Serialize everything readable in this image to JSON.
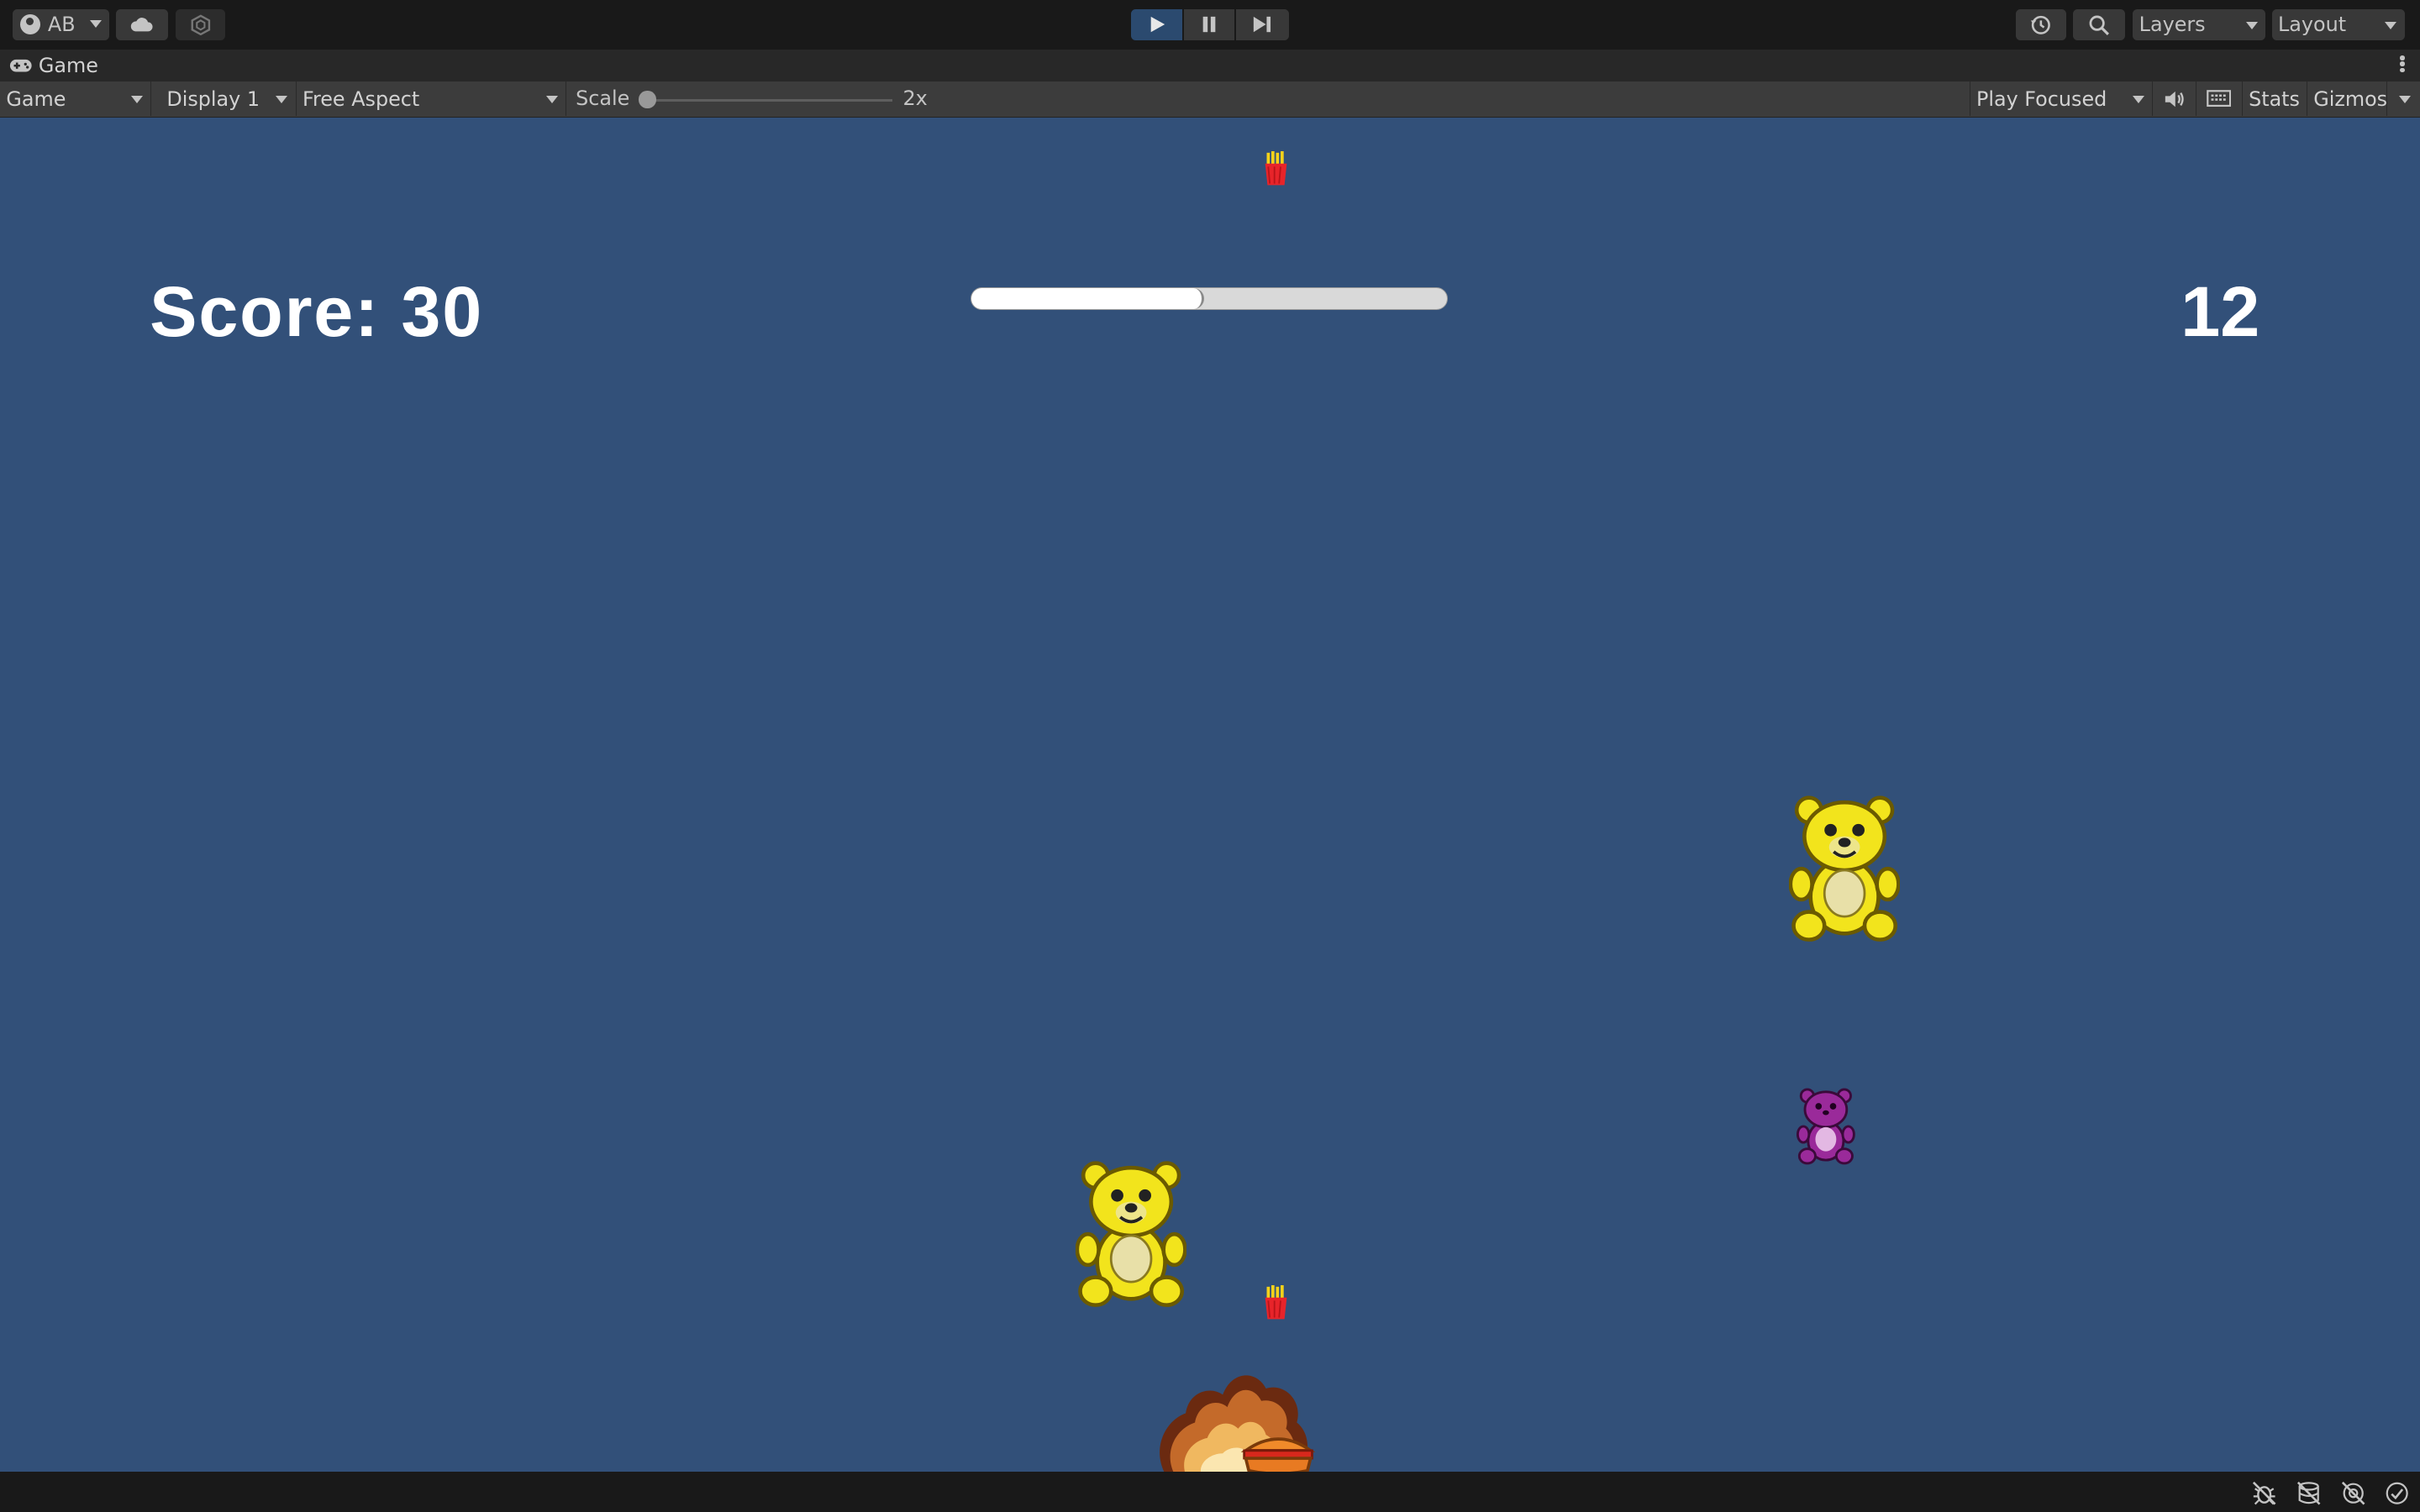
{
  "toolbar_top": {
    "account_label": "AB",
    "layers_label": "Layers",
    "layout_label": "Layout",
    "icons": [
      "account-icon",
      "cloud-icon",
      "collab-icon",
      "play-icon",
      "pause-icon",
      "step-icon",
      "history-icon",
      "search-icon"
    ]
  },
  "tab": {
    "label": "Game",
    "icon": "gamepad-icon"
  },
  "game_toolbar": {
    "view_mode": "Game",
    "display": "Display 1",
    "aspect": "Free Aspect",
    "scale_label": "Scale",
    "scale_value": "2x",
    "play_mode": "Play Focused",
    "stats_label": "Stats",
    "gizmos_label": "Gizmos"
  },
  "hud": {
    "score_text": "Score: 30",
    "timer_text": "12",
    "progress_fraction": 0.49
  },
  "colors": {
    "game_bg": "#325079",
    "hud_text": "#ffffff",
    "play_active": "#2b4a6f"
  },
  "sprites": [
    "french-fries",
    "yellow-teddy-bear",
    "purple-teddy-bear",
    "explosion",
    "burger-player"
  ]
}
